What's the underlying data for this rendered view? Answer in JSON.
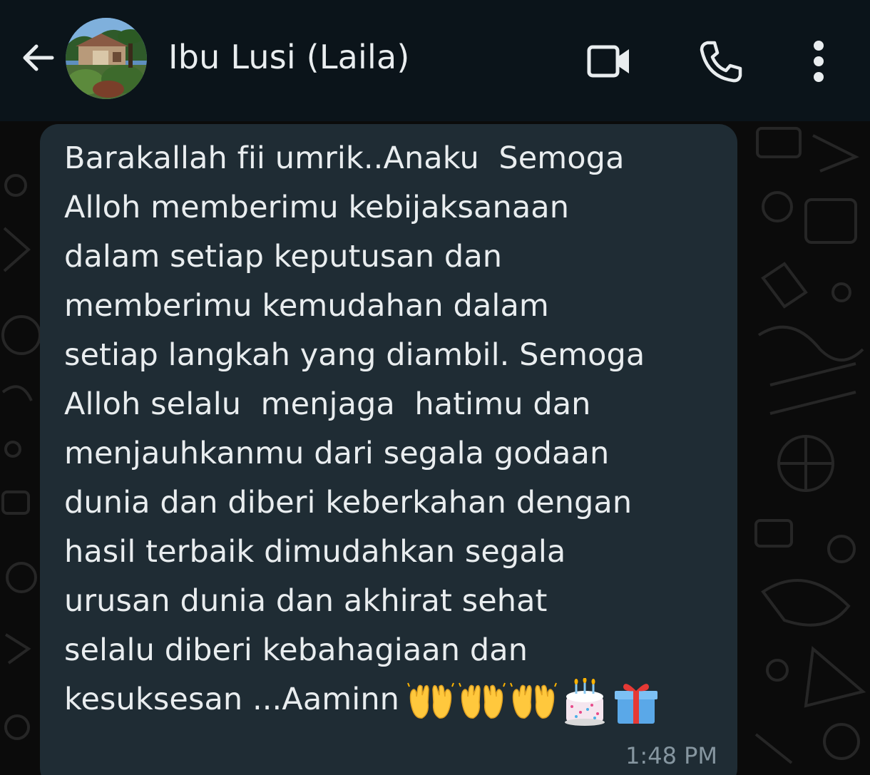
{
  "header": {
    "contact_name": "Ibu Lusi (Laila)",
    "icons": {
      "back": "arrow-back-icon",
      "avatar": "contact-avatar",
      "video": "video-call-icon",
      "call": "phone-icon",
      "menu": "more-vert-icon"
    }
  },
  "message": {
    "lines": [
      "Barakallah fii umrik..Anaku  Semoga",
      "Alloh memberimu kebijaksanaan",
      "dalam setiap keputusan dan",
      "memberimu kemudahan dalam",
      "setiap langkah yang diambil. Semoga",
      "Alloh selalu  menjaga  hatimu dan",
      "menjauhkanmu dari segala godaan",
      "dunia dan diberi keberkahan dengan",
      "hasil terbaik dimudahkan segala",
      "urusan dunia dan akhirat sehat",
      "selalu diberi kebahagiaan dan",
      "kesuksesan ...Aaminn"
    ],
    "emojis": [
      "raising-hands-emoji",
      "raising-hands-emoji",
      "raising-hands-emoji",
      "birthday-cake-emoji",
      "wrapped-gift-emoji"
    ],
    "time": "1:48 PM"
  },
  "colors": {
    "header_bg": "#0b141a",
    "bubble_bg": "#1f2c34",
    "text": "#e9edef",
    "meta": "#8696a0"
  }
}
